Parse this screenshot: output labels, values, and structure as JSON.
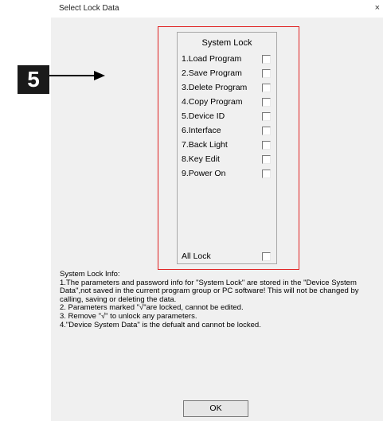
{
  "window": {
    "title": "Select Lock Data",
    "close_glyph": "×"
  },
  "annotation": {
    "step_number": "5"
  },
  "system_lock": {
    "title": "System Lock",
    "items": [
      {
        "label": "1.Load Program",
        "checked": false
      },
      {
        "label": "2.Save Program",
        "checked": false
      },
      {
        "label": "3.Delete Program",
        "checked": false
      },
      {
        "label": "4.Copy Program",
        "checked": false
      },
      {
        "label": "5.Device ID",
        "checked": false
      },
      {
        "label": "6.Interface",
        "checked": false
      },
      {
        "label": "7.Back Light",
        "checked": false
      },
      {
        "label": "8.Key Edit",
        "checked": false
      },
      {
        "label": "9.Power On",
        "checked": false
      }
    ],
    "all_lock": {
      "label": "All Lock",
      "checked": false
    }
  },
  "info": {
    "heading": "System Lock Info:",
    "lines": [
      "1.The parameters and password info for \"System Lock\" are stored in the \"Device System Data\",not saved in the current program group or PC software! This will not be changed by calling, saving or deleting the data.",
      "2. Parameters marked \"√\"are locked, cannot be edited.",
      "3. Remove \"√\" to unlock any parameters.",
      "4.\"Device System Data\" is the defualt and cannot be locked."
    ]
  },
  "footer": {
    "ok_label": "OK"
  },
  "colors": {
    "highlight_frame": "#e02020",
    "dialog_bg": "#f0f0f0"
  }
}
